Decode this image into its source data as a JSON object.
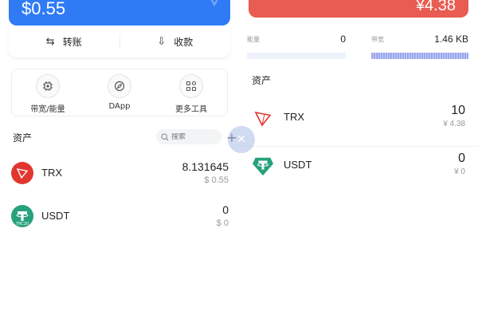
{
  "wallet": {
    "balance": "$0.55",
    "actions": [
      {
        "label": "转账",
        "icon": "transfer-arrows-icon"
      },
      {
        "label": "收款",
        "icon": "receive-arrow-icon"
      }
    ],
    "tools": [
      {
        "label": "带宽/能量",
        "icon": "chip-icon"
      },
      {
        "label": "DApp",
        "icon": "compass-icon"
      },
      {
        "label": "更多工具",
        "icon": "grid-apps-icon"
      }
    ],
    "assets_title": "资产",
    "search_placeholder": "搜索",
    "assets": [
      {
        "symbol": "TRX",
        "amount": "8.131645",
        "fiat": "$ 0.55",
        "color": "#e1362e"
      },
      {
        "symbol": "USDT",
        "amount": "0",
        "fiat": "$ 0",
        "color": "#26a17b",
        "badge": "TRC20"
      }
    ]
  },
  "detail": {
    "balance": "¥4.38",
    "resources": [
      {
        "label": "能量",
        "value": "0",
        "fill": 0.0
      },
      {
        "label": "带宽",
        "value": "1.46 KB",
        "fill": 1.0
      }
    ],
    "assets_title": "资产",
    "assets": [
      {
        "symbol": "TRX",
        "amount": "10",
        "fiat": "¥ 4.38",
        "color": "#e1362e"
      },
      {
        "symbol": "USDT",
        "amount": "0",
        "fiat": "¥ 0",
        "color": "#26a17b"
      }
    ]
  },
  "float_button": {
    "icon": "close-icon",
    "glyph": "✕"
  },
  "colors": {
    "primary": "#2f7bf5",
    "danger": "#e85c51",
    "trx": "#e1362e",
    "usdt": "#26a17b"
  }
}
